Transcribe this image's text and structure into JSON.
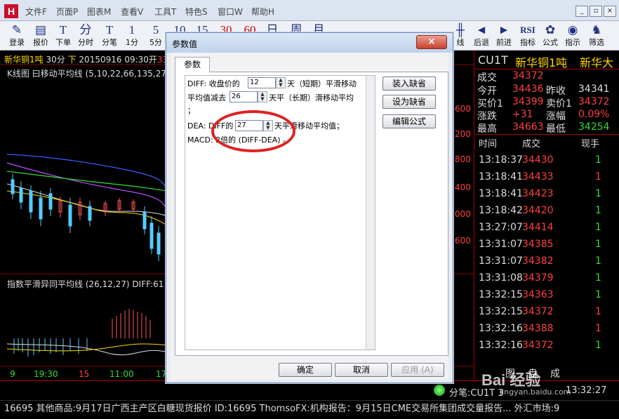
{
  "app": {
    "logo_letter": "H",
    "menu": [
      "文件F",
      "页面P",
      "图表M",
      "查看V",
      "工具T",
      "特色S",
      "窗口W",
      "帮助H"
    ],
    "window_buttons": [
      "_",
      "▫",
      "×"
    ]
  },
  "toolbar": {
    "items": [
      {
        "label": "登录",
        "icon": "✎"
      },
      {
        "label": "报价",
        "icon": "▤"
      },
      {
        "label": "下单",
        "icon": "T"
      },
      {
        "label": "分时",
        "icon": "分"
      },
      {
        "label": "分笔",
        "icon": "T"
      },
      {
        "label": "1分",
        "icon": "1"
      },
      {
        "label": "5分",
        "icon": "5"
      },
      {
        "label": "10",
        "icon": "10"
      },
      {
        "label": "15",
        "icon": "15"
      },
      {
        "label": "30",
        "icon": "30"
      },
      {
        "label": "60",
        "icon": "60"
      },
      {
        "label": "日",
        "icon": "日"
      },
      {
        "label": "周",
        "icon": "周"
      },
      {
        "label": "月",
        "icon": "月"
      }
    ],
    "right_items": [
      {
        "label": "线",
        "icon": "╫"
      },
      {
        "label": "后退",
        "icon": "◄"
      },
      {
        "label": "前进",
        "icon": "►"
      },
      {
        "label": "指标",
        "icon": "RSI"
      },
      {
        "label": "公式",
        "icon": "✿"
      },
      {
        "label": "指示",
        "icon": "◉"
      },
      {
        "label": "筛选",
        "icon": "♞"
      }
    ]
  },
  "chart": {
    "header_name": "新华铜1吨",
    "header_period": "30分",
    "header_dir": "下",
    "header_datetime": "20150916 09:30开",
    "header_tail": "33",
    "kline_title": "K线图 曰移动平均线 (5,10,22,66,135,27",
    "macd_title": "指数平滑异同平均线 (26,12,27)  DIFF:61",
    "y_labels": [
      "600",
      "200",
      "800",
      "400",
      "000",
      "600"
    ],
    "time_axis": [
      "9",
      "19:30",
      "15",
      "11:00",
      "17"
    ]
  },
  "quote": {
    "symbol": "CU1T",
    "name": "新华铜1吨",
    "name_tail": "新华大",
    "rows": [
      {
        "l1": "成交",
        "v1": "34372"
      },
      {
        "l1": "今开",
        "v1": "34436",
        "l2": "昨收",
        "v2": "34341"
      },
      {
        "l1": "买价1",
        "v1": "34399",
        "l2": "卖价1",
        "v2": "34372"
      },
      {
        "l1": "涨跌",
        "v1": "+31",
        "l2": "涨幅",
        "v2": "0.09%"
      },
      {
        "l1": "最高",
        "v1": "34663",
        "l2": "最低",
        "v2": "34254"
      }
    ],
    "trade_headers": [
      "时间",
      "成交",
      "现手"
    ],
    "trades": [
      {
        "time": "13:18:37",
        "price": "34430",
        "vol": "1",
        "pc": "red",
        "vc": "green"
      },
      {
        "time": "13:18:41",
        "price": "34433",
        "vol": "1",
        "pc": "red",
        "vc": "red"
      },
      {
        "time": "13:18:41",
        "price": "34423",
        "vol": "1",
        "pc": "red",
        "vc": "green"
      },
      {
        "time": "13:18:42",
        "price": "34420",
        "vol": "1",
        "pc": "red",
        "vc": "green"
      },
      {
        "time": "13:27:07",
        "price": "34414",
        "vol": "1",
        "pc": "red",
        "vc": "green"
      },
      {
        "time": "13:31:07",
        "price": "34385",
        "vol": "1",
        "pc": "red",
        "vc": "green"
      },
      {
        "time": "13:31:07",
        "price": "34382",
        "vol": "1",
        "pc": "red",
        "vc": "green"
      },
      {
        "time": "13:31:08",
        "price": "34379",
        "vol": "1",
        "pc": "red",
        "vc": "green"
      },
      {
        "time": "13:32:15",
        "price": "34363",
        "vol": "1",
        "pc": "red",
        "vc": "green"
      },
      {
        "time": "13:32:15",
        "price": "34372",
        "vol": "1",
        "pc": "red",
        "vc": "red"
      },
      {
        "time": "13:32:16",
        "price": "34388",
        "vol": "1",
        "pc": "red",
        "vc": "red"
      },
      {
        "time": "13:32:16",
        "price": "34372",
        "vol": "1",
        "pc": "red",
        "vc": "green"
      }
    ],
    "bottom_tabs": [
      "图",
      "盘",
      "成"
    ]
  },
  "status": {
    "indicator_text": "分笔:CU1T 3",
    "clock": "13:32:27"
  },
  "ticker": {
    "text": "16695    其他商品:9月17日广西主产区白糖现货报价 ID:16695    ThomsoFX:机构报告：9月15日CME交易所集团成交量报告...    外汇市场:9"
  },
  "dialog": {
    "title": "参数值",
    "close": "×",
    "tab": "参数",
    "line1_a": "DIFF: 收盘价的",
    "line1_val": "12",
    "line1_b": "天（短期）平滑移动",
    "line2_a": "平均值减去",
    "line2_val": "26",
    "line2_b": "天平（长期）滑移动平均",
    "line3": "；",
    "line4_a": "DEA: DIFF的",
    "line4_val": "27",
    "line4_b": "天平滑移动平均值；",
    "line5": "MACD: 2倍的 (DIFF-DEA) 。",
    "buttons": {
      "load_default": "装入缺省",
      "set_default": "设为缺省",
      "edit_formula": "编辑公式",
      "ok": "确定",
      "cancel": "取消",
      "apply": "应用 (A)"
    }
  },
  "watermark": {
    "text": "Bai 经验",
    "sub": "jingyan.baidu.com"
  }
}
